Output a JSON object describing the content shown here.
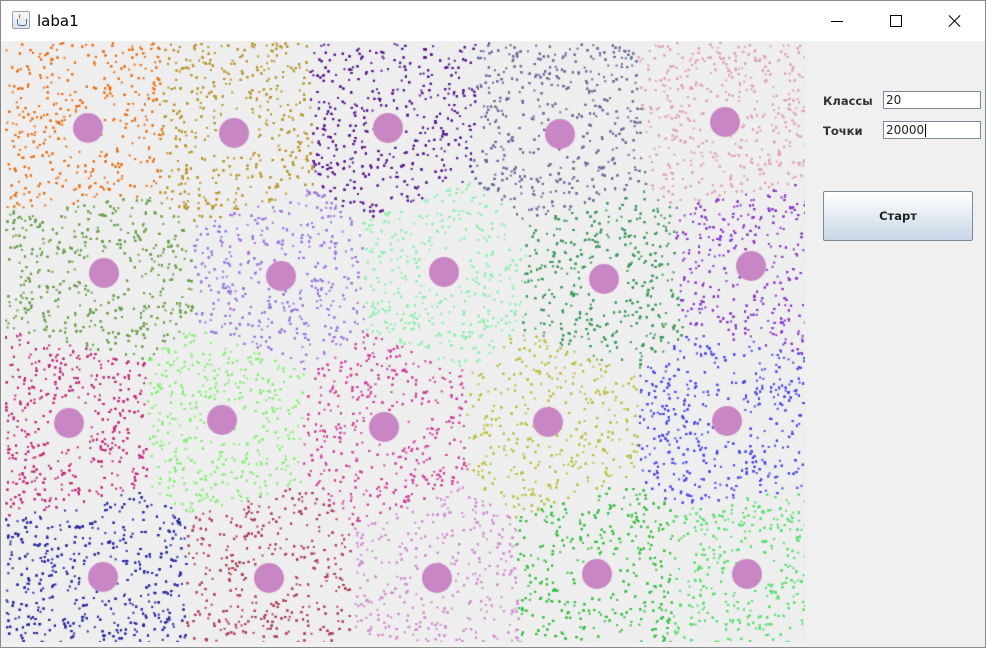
{
  "window": {
    "title": "laba1",
    "icon": "java-cup-icon"
  },
  "controls": {
    "minimize": "minimize-icon",
    "maximize": "maximize-icon",
    "close": "close-icon"
  },
  "form": {
    "classes_label": "Классы",
    "classes_value": "20",
    "points_label": "Точки",
    "points_value": "20000",
    "start_label": "Старт"
  },
  "colors": {
    "center_marker": "#c986c4",
    "canvas_bg": "#eeeeee"
  },
  "clusters": [
    {
      "center": [
        83,
        86
      ],
      "color": "#e8731a"
    },
    {
      "center": [
        229,
        91
      ],
      "color": "#b8962a"
    },
    {
      "center": [
        383,
        86
      ],
      "color": "#5a1a8c"
    },
    {
      "center": [
        555,
        92
      ],
      "color": "#6a6a9a"
    },
    {
      "center": [
        720,
        80
      ],
      "color": "#e0a6b4"
    },
    {
      "center": [
        99,
        231
      ],
      "color": "#6aa04a"
    },
    {
      "center": [
        276,
        234
      ],
      "color": "#9a78e0"
    },
    {
      "center": [
        439,
        230
      ],
      "color": "#8ff0b0"
    },
    {
      "center": [
        599,
        237
      ],
      "color": "#3a9a5a"
    },
    {
      "center": [
        746,
        224
      ],
      "color": "#8a3ac8"
    },
    {
      "center": [
        64,
        381
      ],
      "color": "#c02a7a"
    },
    {
      "center": [
        217,
        378
      ],
      "color": "#88f078"
    },
    {
      "center": [
        379,
        385
      ],
      "color": "#d0449e"
    },
    {
      "center": [
        543,
        380
      ],
      "color": "#bcc040"
    },
    {
      "center": [
        722,
        379
      ],
      "color": "#4a4ae8"
    },
    {
      "center": [
        98,
        535
      ],
      "color": "#2a2aa0"
    },
    {
      "center": [
        264,
        536
      ],
      "color": "#b0405a"
    },
    {
      "center": [
        432,
        536
      ],
      "color": "#d090d0"
    },
    {
      "center": [
        592,
        532
      ],
      "color": "#34c040"
    },
    {
      "center": [
        742,
        532
      ],
      "color": "#58e070"
    }
  ]
}
